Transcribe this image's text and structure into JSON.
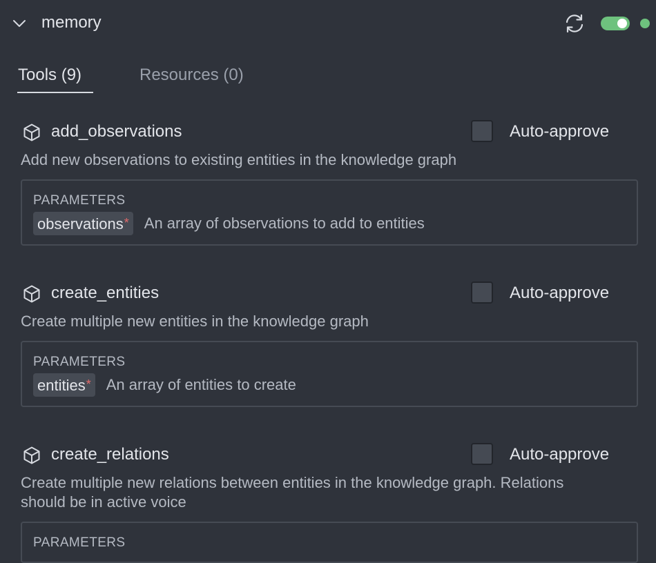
{
  "server": {
    "name": "memory",
    "toggle_on": true,
    "status_color": "#6ec27e"
  },
  "icons": {
    "collapse": "chevron-down-icon",
    "refresh": "refresh-icon",
    "tool": "cube-icon"
  },
  "tabs": [
    {
      "label": "Tools (9)",
      "active": true
    },
    {
      "label": "Resources (0)",
      "active": false
    }
  ],
  "tools": [
    {
      "name": "add_observations",
      "auto_approve_label": "Auto-approve",
      "auto_approve": false,
      "description": "Add new observations to existing entities in the knowledge graph",
      "params_title": "PARAMETERS",
      "params": [
        {
          "name": "observations",
          "required": "*",
          "description": "An array of observations to add to entities"
        }
      ]
    },
    {
      "name": "create_entities",
      "auto_approve_label": "Auto-approve",
      "auto_approve": false,
      "description": "Create multiple new entities in the knowledge graph",
      "params_title": "PARAMETERS",
      "params": [
        {
          "name": "entities",
          "required": "*",
          "description": "An array of entities to create"
        }
      ]
    },
    {
      "name": "create_relations",
      "auto_approve_label": "Auto-approve",
      "auto_approve": false,
      "description": "Create multiple new relations between entities in the knowledge graph. Relations should be in active voice",
      "params_title": "PARAMETERS",
      "params": []
    }
  ]
}
